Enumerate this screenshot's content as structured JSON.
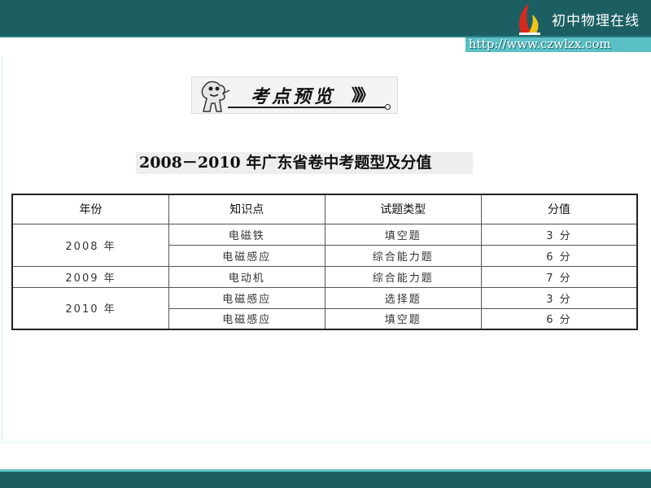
{
  "header": {
    "site_name": "初中物理在线",
    "url": "http://www.czwlzx.com"
  },
  "badge": {
    "title": "考点预览",
    "arrows": "》》》"
  },
  "table": {
    "heading": "2008－2010 年广东省卷中考题型及分值",
    "columns": [
      "年份",
      "知识点",
      "试题类型",
      "分值"
    ],
    "rows": [
      {
        "year": "2008 年",
        "topic": "电磁铁",
        "type": "填空题",
        "score": "3 分"
      },
      {
        "year": "",
        "topic": "电磁感应",
        "type": "综合能力题",
        "score": "6 分"
      },
      {
        "year": "2009 年",
        "topic": "电动机",
        "type": "综合能力题",
        "score": "7 分"
      },
      {
        "year": "2010 年",
        "topic": "电磁感应",
        "type": "选择题",
        "score": "3 分"
      },
      {
        "year": "",
        "topic": "电磁感应",
        "type": "填空题",
        "score": "6 分"
      }
    ]
  },
  "colors": {
    "banner": "#1b5f63",
    "accent": "#5bc0c6",
    "logo_red": "#d8281e",
    "logo_yellow": "#f2c21b"
  }
}
